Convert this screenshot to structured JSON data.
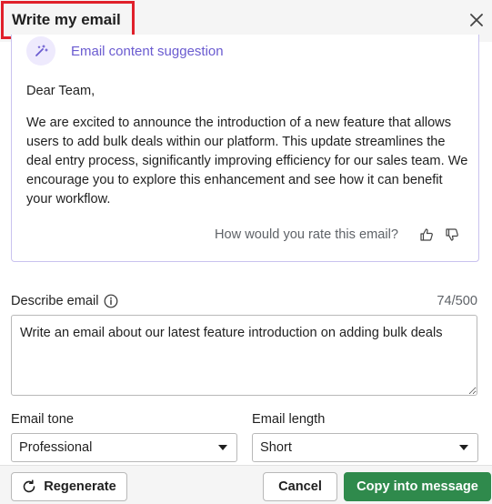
{
  "header": {
    "title": "Write my email"
  },
  "suggestion": {
    "label": "Email content suggestion",
    "greeting": "Dear Team,",
    "body": "We are excited to announce the introduction of a new feature that allows users to add bulk deals within our platform. This update streamlines the deal entry process, significantly improving efficiency for our sales team. We encourage you to explore this enhancement and see how it can benefit your workflow.",
    "rate_prompt": "How would you rate this email?"
  },
  "describe": {
    "label": "Describe email",
    "count": "74/500",
    "value": "Write an email about our latest feature introduction on adding bulk deals"
  },
  "tone": {
    "label": "Email tone",
    "selected": "Professional"
  },
  "length": {
    "label": "Email length",
    "selected": "Short"
  },
  "footer": {
    "regenerate_label": "Regenerate",
    "cancel_label": "Cancel",
    "copy_label": "Copy into message"
  },
  "colors": {
    "accent_purple": "#6a5bd0",
    "primary_green": "#2f8a4c",
    "highlight_red": "#e0202a"
  }
}
